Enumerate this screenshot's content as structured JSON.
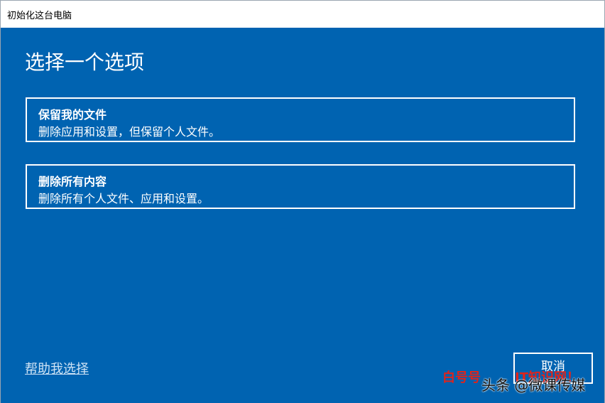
{
  "window": {
    "title": "初始化这台电脑"
  },
  "main": {
    "heading": "选择一个选项",
    "options": [
      {
        "title": "保留我的文件",
        "description": "删除应用和设置，但保留个人文件。"
      },
      {
        "title": "删除所有内容",
        "description": "删除所有个人文件、应用和设置。"
      }
    ],
    "help_link": "帮助我选择",
    "cancel_label": "取消"
  },
  "watermark": {
    "left": "白号号",
    "right": "IT知识网！",
    "bottom": "头条 @微课传媒"
  },
  "colors": {
    "background": "#0063b1",
    "text": "#ffffff",
    "titlebar": "#ffffff"
  }
}
